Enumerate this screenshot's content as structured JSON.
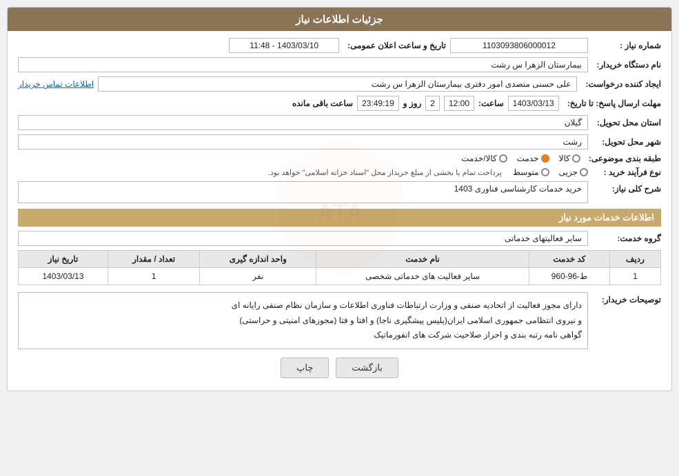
{
  "header": {
    "title": "جزئیات اطلاعات نیاز"
  },
  "fields": {
    "need_number_label": "شماره نیاز :",
    "need_number_value": "1103093806000012",
    "org_name_label": "نام دستگاه خریدار:",
    "org_name_value": "بیمارستان الزهرا  س  رشت",
    "announce_date_label": "تاریخ و ساعت اعلان عمومی:",
    "announce_date_value": "1403/03/10 - 11:48",
    "creator_label": "ایجاد کننده درخواست:",
    "creator_value": "علی حسنی متصدی امور دفتری بیمارستان الزهرا  س  رشت",
    "contact_link": "اطلاعات تماس خریدار",
    "deadline_label": "مهلت ارسال پاسخ: تا تاریخ:",
    "deadline_date": "1403/03/13",
    "deadline_time_label": "ساعت:",
    "deadline_time": "12:00",
    "deadline_day_label": "روز و",
    "deadline_days": "2",
    "deadline_remaining_label": "ساعت باقی مانده",
    "deadline_remaining": "23:49:19",
    "province_label": "استان محل تحویل:",
    "province_value": "گیلان",
    "city_label": "شهر محل تحویل:",
    "city_value": "رشت",
    "category_label": "طبقه بندی موضوعی:",
    "category_options": [
      {
        "label": "کالا",
        "selected": false
      },
      {
        "label": "خدمت",
        "selected": true
      },
      {
        "label": "کالا/خدمت",
        "selected": false
      }
    ],
    "process_label": "نوع فرآیند خرید :",
    "process_options": [
      {
        "label": "جزیی",
        "selected": false
      },
      {
        "label": "متوسط",
        "selected": false
      }
    ],
    "process_note": "پرداخت تمام یا بخشی از مبلغ خریداز محل \"اسناد خزانه اسلامی\" خواهد بود.",
    "need_desc_label": "شرح کلی نیاز:",
    "need_desc_value": "خرید خدمات کارشناسی فناوری 1403",
    "service_info_title": "اطلاعات خدمات مورد نیاز",
    "service_group_label": "گروه خدمت:",
    "service_group_value": "سایر فعالیتهای خدماتی",
    "table": {
      "headers": [
        "ردیف",
        "کد خدمت",
        "نام خدمت",
        "واحد اندازه گیری",
        "تعداد / مقدار",
        "تاریخ نیاز"
      ],
      "rows": [
        {
          "row": "1",
          "code": "ط-96-960",
          "name": "سایر فعالیت های خدماتی شخصی",
          "unit": "نفر",
          "quantity": "1",
          "date": "1403/03/13"
        }
      ]
    },
    "buyer_desc_label": "توصیحات خریدار:",
    "buyer_desc_value": "دارای مجوز فعالیت از اتحادیه صنفی و وزارت ارتباطات فناوری اطلاعات و سازمان نظام صنفی رایانه ای\nو نیروی انتظامی جمهوری اسلامی ایران(پلیس پیشگیری ناجا) و افتا و فتا (مجوزهای امنیتی و حراستی)\nگواهی نامه رتبه بندی و احراز صلاحیت شرکت های انفورماتیک"
  },
  "buttons": {
    "print_label": "چاپ",
    "back_label": "بازگشت"
  }
}
